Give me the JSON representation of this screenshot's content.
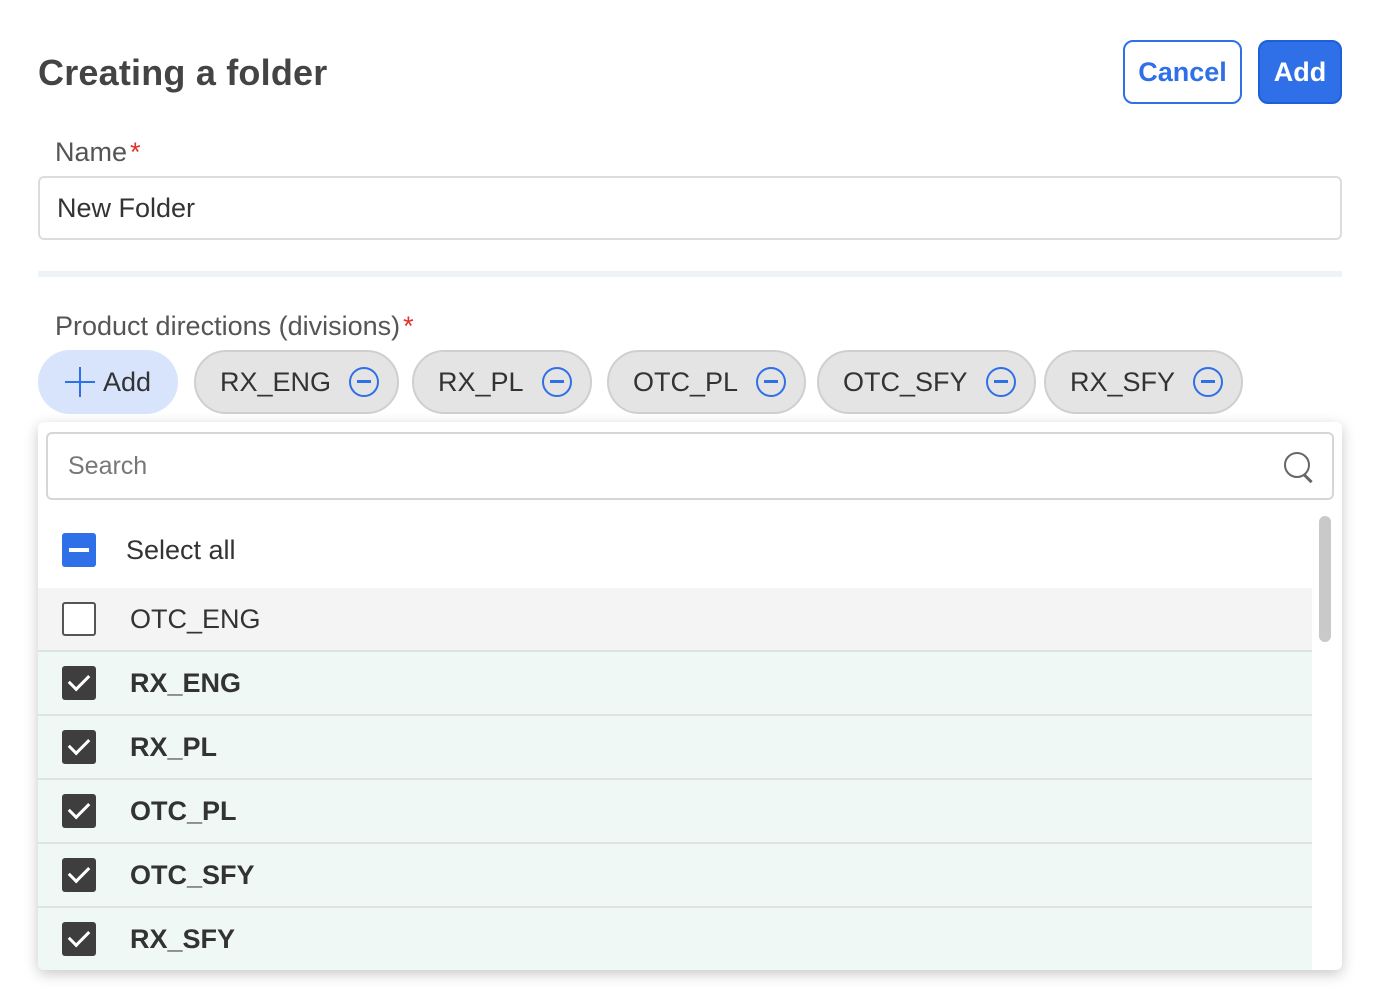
{
  "header": {
    "title": "Creating a folder",
    "cancel_label": "Cancel",
    "add_label": "Add"
  },
  "name_field": {
    "label": "Name",
    "required_mark": "*",
    "value": "New Folder"
  },
  "divisions": {
    "label": "Product directions (divisions)",
    "required_mark": "*",
    "add_label": "Add",
    "chips": [
      "RX_ENG",
      "RX_PL",
      "OTC_PL",
      "OTC_SFY",
      "RX_SFY"
    ]
  },
  "dropdown": {
    "search_placeholder": "Search",
    "select_all_label": "Select all",
    "select_all_state": "indeterminate",
    "options": [
      {
        "label": "OTC_ENG",
        "checked": false
      },
      {
        "label": "RX_ENG",
        "checked": true
      },
      {
        "label": "RX_PL",
        "checked": true
      },
      {
        "label": "OTC_PL",
        "checked": true
      },
      {
        "label": "OTC_SFY",
        "checked": true
      },
      {
        "label": "RX_SFY",
        "checked": true
      }
    ]
  },
  "colors": {
    "accent": "#2f6fe8",
    "required": "#e0312b",
    "selected_row": "#eff8f5"
  }
}
